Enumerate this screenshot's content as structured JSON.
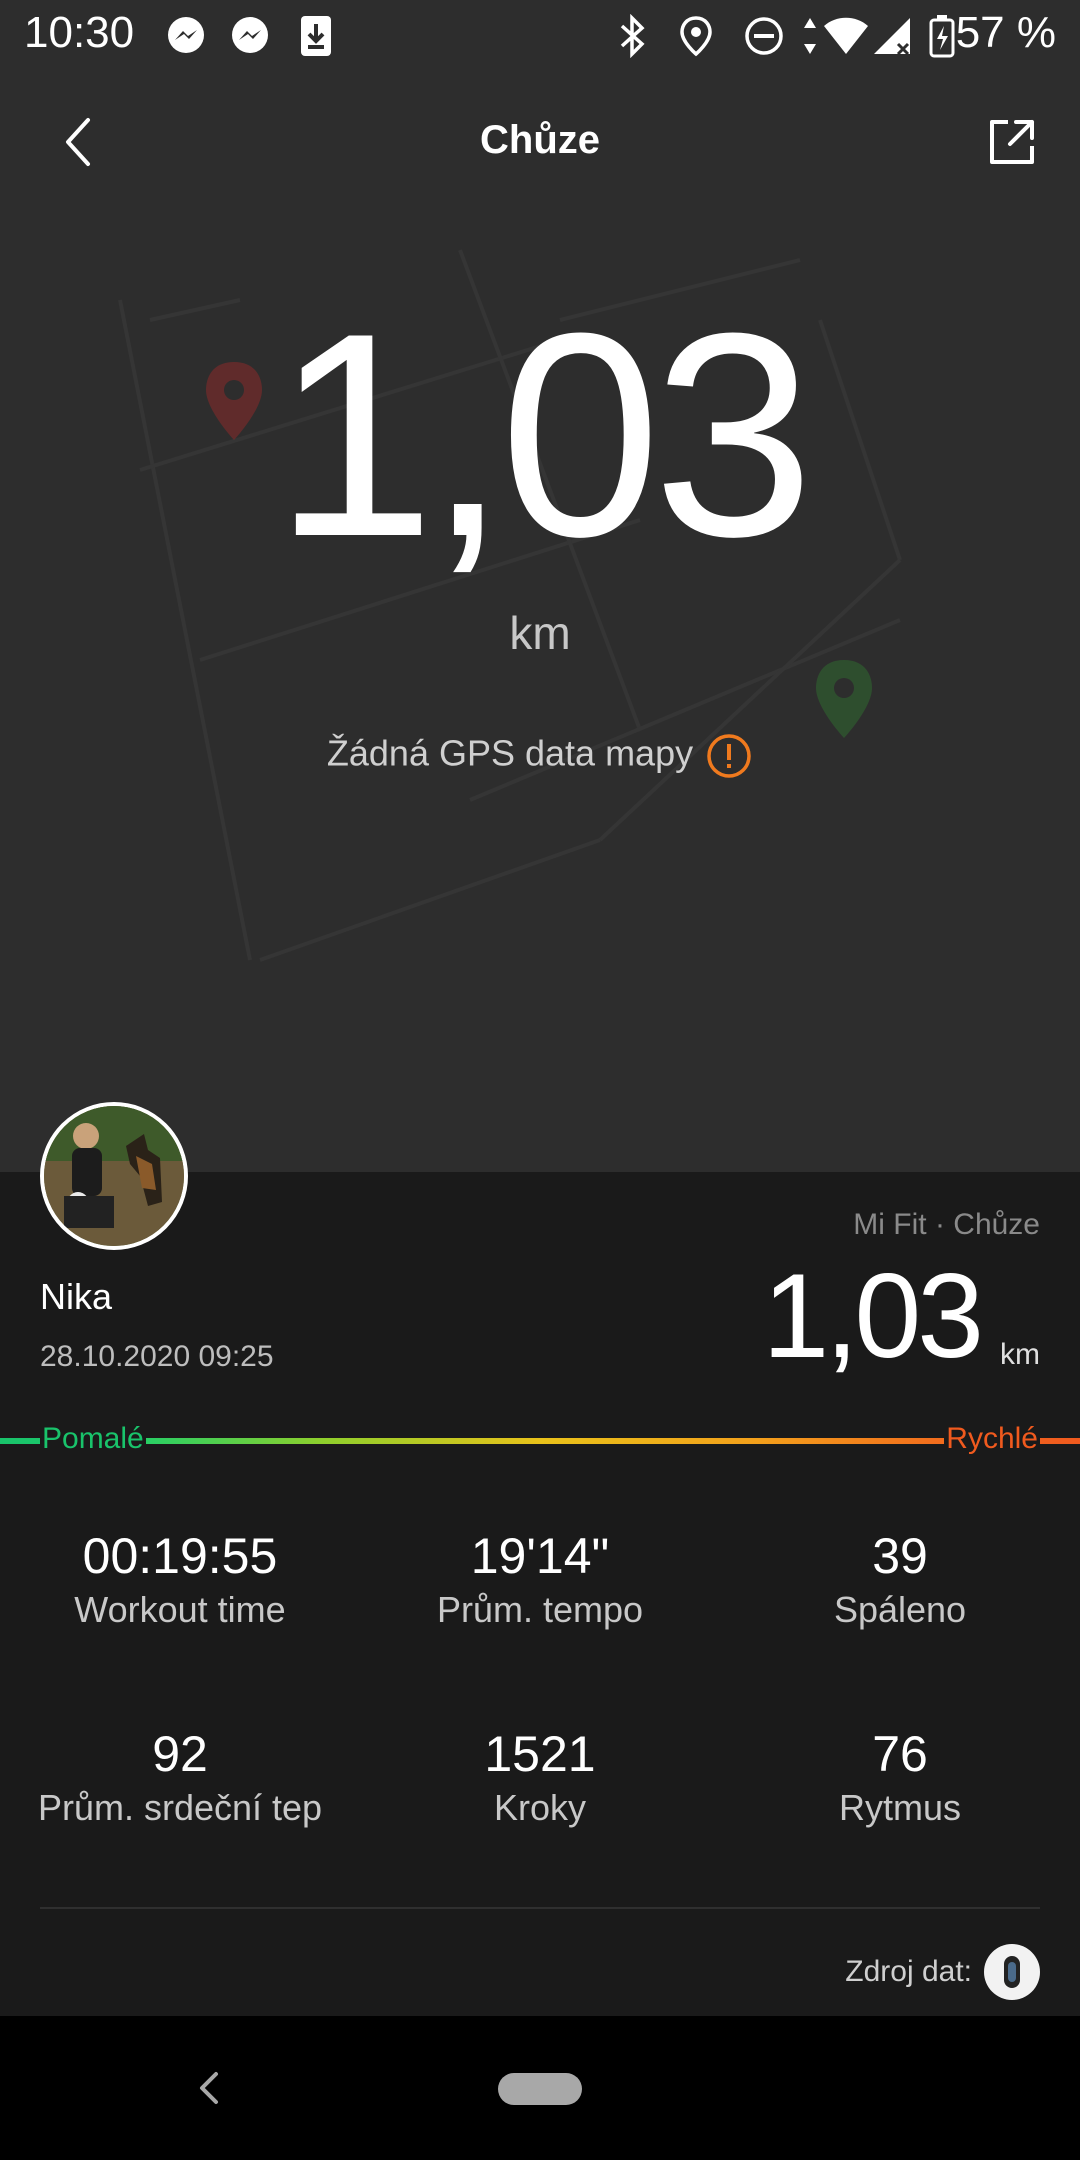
{
  "status_bar": {
    "time": "10:30",
    "battery_percent": "57 %",
    "icons": [
      "messenger-icon",
      "messenger-icon",
      "download-icon",
      "bluetooth-icon",
      "location-icon",
      "do-not-disturb-icon",
      "data-arrows-icon",
      "wifi-icon",
      "signal-icon",
      "battery-icon"
    ]
  },
  "header": {
    "title": "Chůze"
  },
  "hero": {
    "distance": "1,03",
    "unit": "km",
    "gps_note": "Žádná GPS data mapy"
  },
  "summary": {
    "source": "Mi Fit · Chůze",
    "user_name": "Nika",
    "datetime": "28.10.2020 09:25",
    "distance": "1,03",
    "unit": "km",
    "speed_slow_label": "Pomalé",
    "speed_fast_label": "Rychlé"
  },
  "stats": [
    {
      "value": "00:19:55",
      "label": "Workout time"
    },
    {
      "value": "19'14\"",
      "label": "Prům. tempo"
    },
    {
      "value": "39",
      "label": "Spáleno"
    },
    {
      "value": "92",
      "label": "Prům. srdeční tep"
    },
    {
      "value": "1521",
      "label": "Kroky"
    },
    {
      "value": "76",
      "label": "Rytmus"
    }
  ],
  "footer": {
    "data_source_label": "Zdroj dat:"
  },
  "colors": {
    "slow": "#19c36b",
    "fast": "#f05a1e",
    "warning": "#f07a1e",
    "background": "#1a1a1a",
    "map_background": "#2d2d2d"
  }
}
